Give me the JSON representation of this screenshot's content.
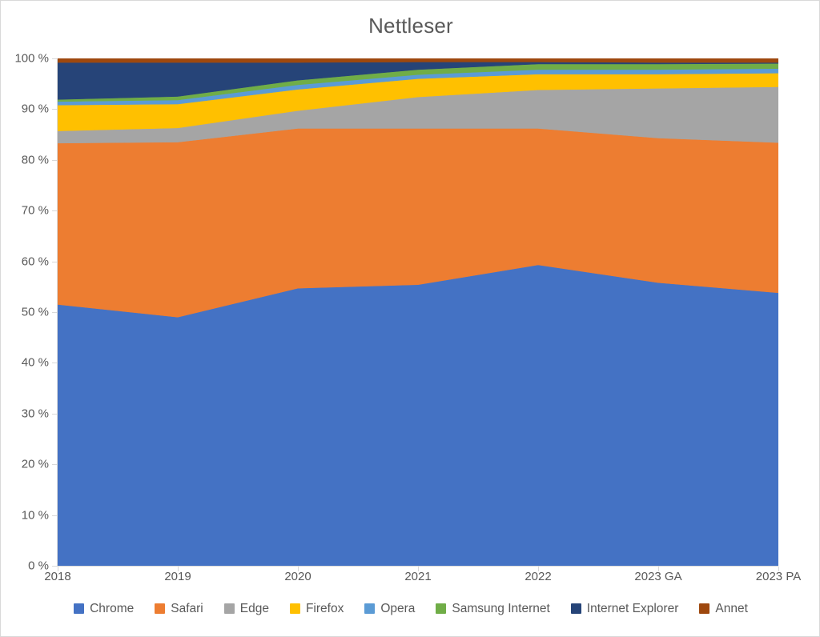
{
  "chart": {
    "title": "Nettleser"
  },
  "axes": {
    "y_tick_labels": [
      "0 %",
      "10 %",
      "20 %",
      "30 %",
      "40 %",
      "50 %",
      "60 %",
      "70 %",
      "80 %",
      "90 %",
      "100 %"
    ],
    "x_tick_labels": [
      "2018",
      "2019",
      "2020",
      "2021",
      "2022",
      "2023 GA",
      "2023 PA"
    ]
  },
  "legend": {
    "items": [
      {
        "label": "Chrome",
        "color": "#4472C4"
      },
      {
        "label": "Safari",
        "color": "#ED7D31"
      },
      {
        "label": "Edge",
        "color": "#A5A5A5"
      },
      {
        "label": "Firefox",
        "color": "#FFC000"
      },
      {
        "label": "Opera",
        "color": "#5B9BD5"
      },
      {
        "label": "Samsung Internet",
        "color": "#70AD47"
      },
      {
        "label": "Internet Explorer",
        "color": "#264478"
      },
      {
        "label": "Annet",
        "color": "#9E480E"
      }
    ]
  },
  "chart_data": {
    "type": "area",
    "stacked": true,
    "normalized": true,
    "title": "Nettleser",
    "xlabel": "",
    "ylabel": "",
    "ylim": [
      0,
      100
    ],
    "ytick_format": "0 %",
    "yticks": [
      0,
      10,
      20,
      30,
      40,
      50,
      60,
      70,
      80,
      90,
      100
    ],
    "grid": false,
    "legend_position": "bottom",
    "categories": [
      "2018",
      "2019",
      "2020",
      "2021",
      "2022",
      "2023 GA",
      "2023 PA"
    ],
    "series": [
      {
        "name": "Chrome",
        "color": "#4472C4",
        "values": [
          51.5,
          49.0,
          54.7,
          55.4,
          59.3,
          55.8,
          53.8
        ]
      },
      {
        "name": "Safari",
        "color": "#ED7D31",
        "values": [
          31.8,
          34.5,
          31.5,
          30.8,
          26.9,
          28.5,
          29.6
        ]
      },
      {
        "name": "Edge",
        "color": "#A5A5A5",
        "values": [
          2.4,
          2.8,
          3.5,
          6.2,
          7.6,
          9.8,
          11.0
        ]
      },
      {
        "name": "Firefox",
        "color": "#FFC000",
        "values": [
          5.1,
          4.7,
          4.2,
          3.6,
          3.1,
          2.8,
          2.7
        ]
      },
      {
        "name": "Opera",
        "color": "#5B9BD5",
        "values": [
          0.7,
          0.8,
          0.9,
          0.8,
          0.9,
          0.9,
          0.9
        ]
      },
      {
        "name": "Samsung Internet",
        "color": "#70AD47",
        "values": [
          0.4,
          0.7,
          0.9,
          1.0,
          1.1,
          1.1,
          1.0
        ]
      },
      {
        "name": "Internet Explorer",
        "color": "#264478",
        "values": [
          7.3,
          6.7,
          3.5,
          1.5,
          0.4,
          0.3,
          0.2
        ]
      },
      {
        "name": "Annet",
        "color": "#9E480E",
        "values": [
          0.8,
          0.8,
          0.8,
          0.7,
          0.7,
          0.8,
          0.8
        ]
      }
    ]
  }
}
